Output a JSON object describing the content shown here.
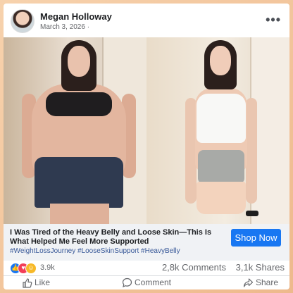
{
  "post": {
    "author": "Megan Holloway",
    "date": "March 3, 2026 ·",
    "more_icon": "more-dots-icon"
  },
  "ad": {
    "headline": "I Was Tired of the Heavy Belly and Loose Skin—This Is What Helped Me Feel More Supported",
    "hashtags": "#WeightLossJourney #LooseSkinSupport #HeavyBelly",
    "cta": "Shop Now",
    "cta_color": "#1877f2"
  },
  "stats": {
    "reaction_icons": [
      "like-icon",
      "love-icon",
      "haha-icon"
    ],
    "reactions_count": "3.9k",
    "comments": "2,8k Comments",
    "shares": "3,1k Shares"
  },
  "actions": {
    "like": "Like",
    "comment": "Comment",
    "share": "Share"
  }
}
